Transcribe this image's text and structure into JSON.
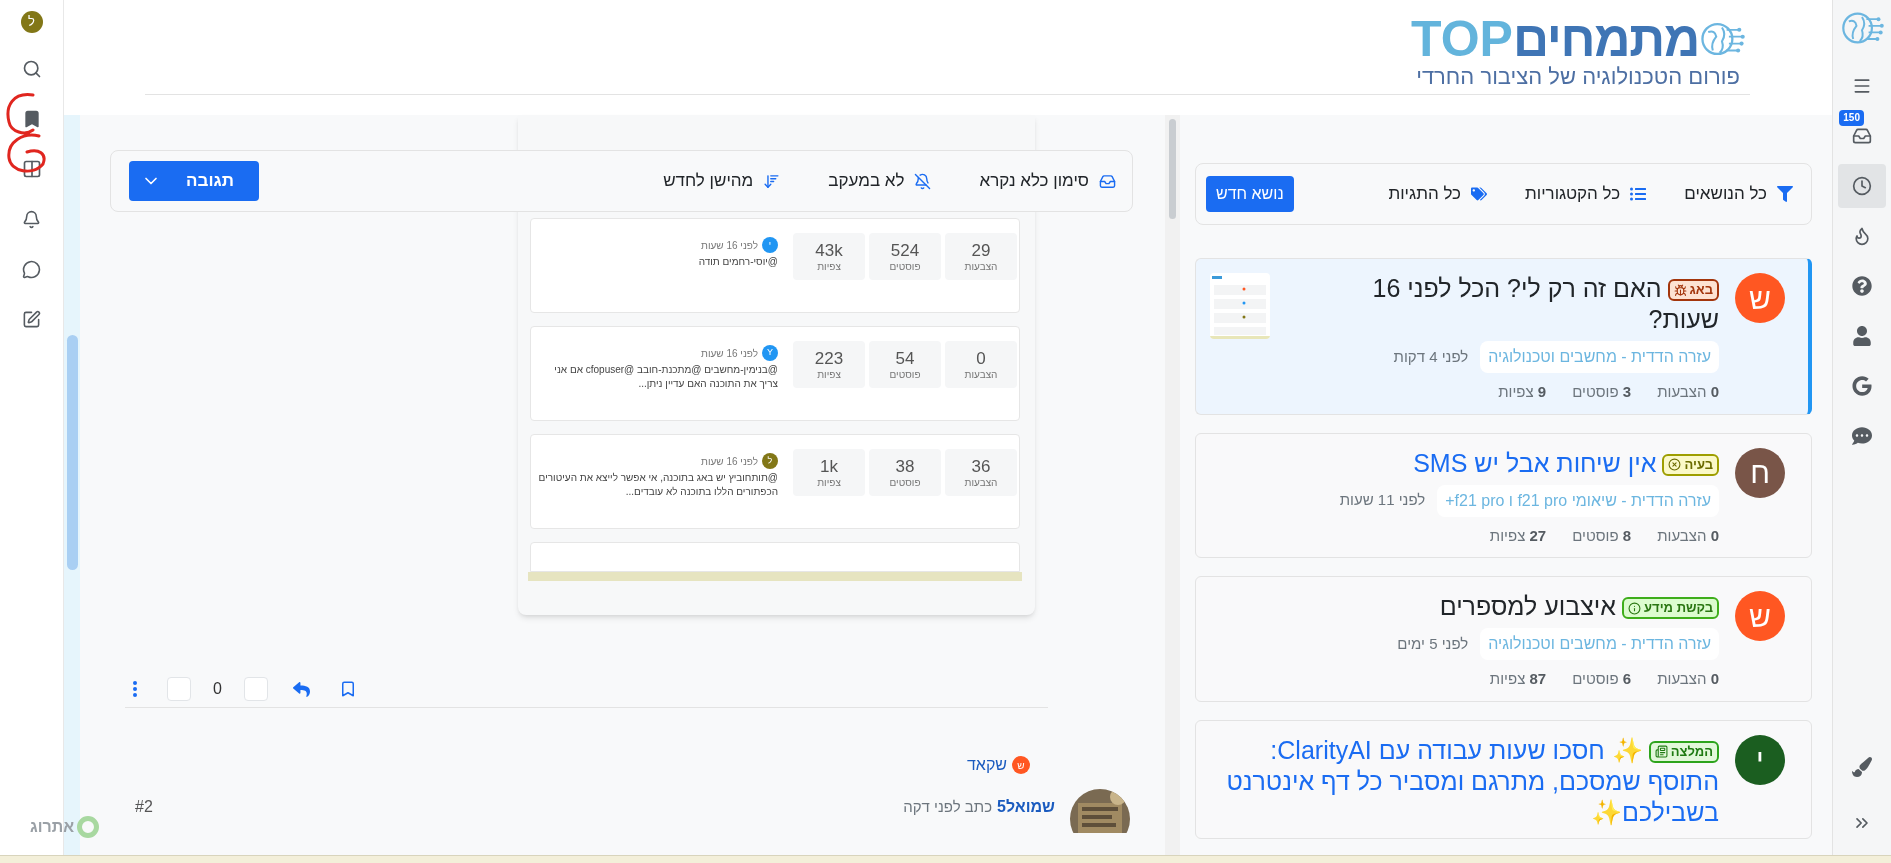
{
  "left_bar": {
    "avatar": "ל"
  },
  "header": {
    "logo_main": "מתמחים",
    "logo_accent": "TOP",
    "tagline": "פורום הטכנולוגיה של הציבור החרדי"
  },
  "right_bar": {
    "items": [
      {
        "kind": "menu",
        "selected": false
      },
      {
        "kind": "inbox",
        "selected": false,
        "badge": "150"
      },
      {
        "kind": "recent",
        "selected": true
      },
      {
        "kind": "popular",
        "selected": false
      },
      {
        "kind": "help",
        "selected": false
      },
      {
        "kind": "user",
        "selected": false
      },
      {
        "kind": "google",
        "selected": false
      },
      {
        "kind": "chats",
        "selected": false
      }
    ],
    "bottom_items": [
      {
        "kind": "brush"
      },
      {
        "kind": "expand"
      }
    ]
  },
  "filter_bar": {
    "items": [
      {
        "kind": "filter",
        "label": "כל הנושאים"
      },
      {
        "kind": "categories",
        "label": "כל הקטגוריות"
      },
      {
        "kind": "tags",
        "label": "כל התגיות"
      }
    ],
    "new_topic": "נושא חדש"
  },
  "topics": [
    {
      "avatar": "ש",
      "color": "#ff5722",
      "tag": {
        "kind": "bug",
        "label": "באג"
      },
      "title": "האם זה רק לי? הכל לפני 16 שעות?",
      "unread": false,
      "selected": true,
      "thumbnail": {
        "kind": "picture"
      },
      "category": "עזרה הדדית - מחשבים וטכנולוגיה",
      "time": "לפני 4 דקות",
      "stats": [
        "**0** הצבעות",
        "**3** פוסטים",
        "**9** צפיות"
      ]
    },
    {
      "avatar": "ח",
      "color": "#795548",
      "tag": {
        "kind": "problem",
        "label": "בעיה"
      },
      "title": "אין שיחות אבל יש SMS",
      "unread": true,
      "selected": false,
      "category": "עזרה הדדית - שיאומי f21 pro ו f21 pro+",
      "time": "לפני 11 שעות",
      "stats": [
        "**0** הצבעות",
        "**8** פוסטים",
        "**27** צפיות"
      ]
    },
    {
      "avatar": "ש",
      "color": "#ff5722",
      "tag": {
        "kind": "info",
        "label": "בקשת מידע"
      },
      "title": "איצבוע למספרים",
      "unread": false,
      "selected": false,
      "category": "עזרה הדדית - מחשבים וטכנולוגיה",
      "time": "לפני 5 ימים",
      "stats": [
        "**0** הצבעות",
        "**6** פוסטים",
        "**87** צפיות"
      ]
    },
    {
      "avatar": "י",
      "color": "#1b5e20",
      "tag": {
        "kind": "recommended",
        "label": "המלצה"
      },
      "title": "✨ חסכו שעות עבודה עם ClarityAI: התוסף שמסכם, מתרגם ומסביר כל דף אינטרנט בשבילכם✨",
      "unread": true,
      "selected": false
    }
  ],
  "post_toolbar": {
    "items": [
      {
        "kind": "mark-unread",
        "label": "סימון כלא נקרא"
      },
      {
        "kind": "watch",
        "label": "לא במעקב"
      },
      {
        "kind": "sort",
        "label": "מהישן לחדש"
      }
    ],
    "reply": "תגובה"
  },
  "embedded_screenshot": {
    "rows": [
      {
        "avatar": "י",
        "color": "#2196f3",
        "time": "לפני 16 שעות",
        "text": "@יוסי-רחמים תודה",
        "stats": [
          {
            "value": "29",
            "label": "הצבעות"
          },
          {
            "value": "524",
            "label": "פוסטים"
          },
          {
            "value": "43k",
            "label": "צפיות"
          }
        ]
      },
      {
        "avatar": "Y",
        "color": "#2196f3",
        "time": "לפני 16 שעות",
        "text": "@בנימין-מחשבים @מתכנת-חובב @cfopuser אם אני צריך את התוכנה האם עדיין ניתן...",
        "stats": [
          {
            "value": "0",
            "label": "הצבעות"
          },
          {
            "value": "54",
            "label": "פוסטים"
          },
          {
            "value": "223",
            "label": "צפיות"
          }
        ]
      },
      {
        "avatar": "ל",
        "color": "#827717",
        "time": "לפני 16 שעות",
        "text": "@תותחוביץ יש באג בתוכנה, אי אפשר לייצא את העיטורים הכפתורים הללו בתוכנה לא עובדים...",
        "stats": [
          {
            "value": "36",
            "label": "הצבעות"
          },
          {
            "value": "38",
            "label": "פוסטים"
          },
          {
            "value": "1k",
            "label": "צפיות"
          }
        ]
      }
    ]
  },
  "post_actions": {
    "votes": "0"
  },
  "next_post": {
    "tag_avatar": "ש",
    "tag_name": "שקאד",
    "author": "שמואל5",
    "action": "כתב לפני דקה",
    "index": "#2"
  },
  "floating_badge": {
    "label": "אתרוג"
  }
}
